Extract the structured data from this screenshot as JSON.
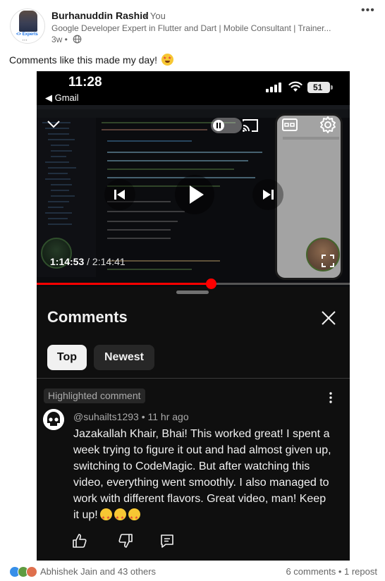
{
  "post": {
    "author_name": "Burhanuddin Rashid",
    "author_you": "• You",
    "headline": "Google Developer Expert in Flutter and Dart | Mobile Consultant | Trainer...",
    "time": "3w •",
    "text": "Comments like this made my day!",
    "emoji": "star-struck-emoji"
  },
  "phone": {
    "status_time": "11:28",
    "back_label": "◀ Gmail",
    "battery": "51"
  },
  "video": {
    "current_time": "1:14:53",
    "duration": " / 2:14:41",
    "progress": 0.556
  },
  "comments": {
    "title": "Comments",
    "tabs": [
      {
        "label": "Top",
        "selected": true
      },
      {
        "label": "Newest",
        "selected": false
      }
    ],
    "highlight_label": "Highlighted comment",
    "comment": {
      "author": "@suhailts1293",
      "time": "• 11 hr ago",
      "text": "Jazakallah Khair, Bhai! This worked great! I spent a week trying to figure it out and had almost given up, switching to CodeMagic. But after watching this video, everything went smoothly. I also managed to work with different flavors. Great video, man! Keep it up!",
      "emoji_count": 3
    }
  },
  "footer": {
    "reactions": "Abhishek Jain and 43 others",
    "engagement": "6 comments • 1 repost"
  },
  "colors": {
    "youtube_red": "#ff0000",
    "dark_bg": "#0f0f0f",
    "linkedin_gray": "#666666"
  }
}
